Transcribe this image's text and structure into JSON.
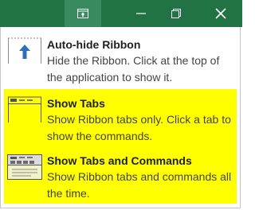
{
  "colors": {
    "title_bar": "#217346",
    "highlight": "#ffff00",
    "arrow": "#2e6fbb"
  },
  "title_bar": {
    "buttons": [
      {
        "name": "ribbon-display-options",
        "icon": "ribbon-display-options-icon"
      },
      {
        "name": "minimize",
        "icon": "minimize-icon"
      },
      {
        "name": "restore",
        "icon": "restore-icon"
      },
      {
        "name": "close",
        "icon": "close-icon"
      }
    ]
  },
  "menu": {
    "items": [
      {
        "label": "Auto-hide Ribbon",
        "description": "Hide the Ribbon. Click at the top of the application to show it.",
        "icon": "auto-hide-ribbon-icon"
      },
      {
        "label": "Show Tabs",
        "description": "Show Ribbon tabs only. Click a tab to show the commands.",
        "icon": "show-tabs-icon"
      },
      {
        "label": "Show Tabs and Commands",
        "description": "Show Ribbon tabs and commands all the time.",
        "icon": "show-tabs-and-commands-icon"
      }
    ]
  }
}
